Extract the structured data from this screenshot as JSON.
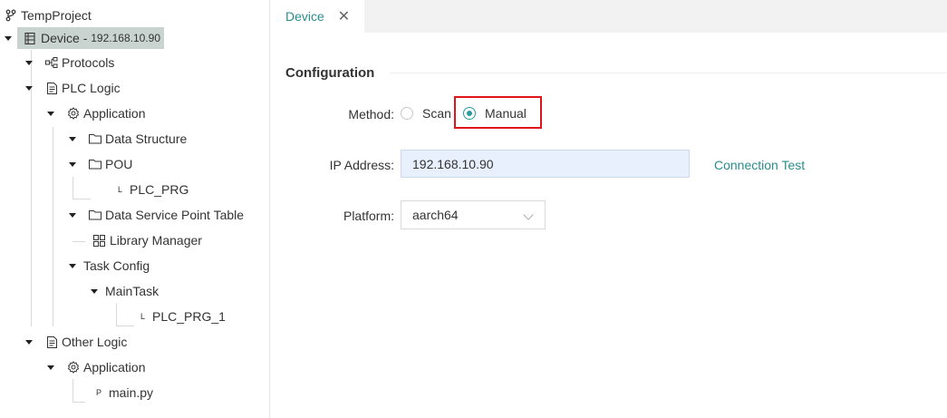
{
  "tree": {
    "root": {
      "label": "TempProject",
      "icon": "branch-icon"
    },
    "device": {
      "label": "Device - ",
      "ip": "192.168.10.90",
      "icon": "device-icon"
    },
    "protocols": {
      "label": "Protocols",
      "icon": "protocols-icon"
    },
    "plc_logic": {
      "label": "PLC Logic",
      "icon": "file-icon"
    },
    "application": {
      "label": "Application",
      "icon": "gear-icon"
    },
    "data_structure": {
      "label": "Data Structure",
      "icon": "folder-icon"
    },
    "pou": {
      "label": "POU",
      "icon": "folder-icon"
    },
    "plc_prg": {
      "label": "PLC_PRG",
      "prefix": "L"
    },
    "data_service": {
      "label": "Data Service Point Table",
      "icon": "folder-icon"
    },
    "library_manager": {
      "label": "Library Manager",
      "icon": "grid-icon"
    },
    "task_config": {
      "label": "Task Config"
    },
    "main_task": {
      "label": "MainTask"
    },
    "plc_prg_1": {
      "label": "PLC_PRG_1",
      "prefix": "L"
    },
    "other_logic": {
      "label": "Other Logic",
      "icon": "file-icon"
    },
    "application2": {
      "label": "Application",
      "icon": "gear-icon"
    },
    "main_py": {
      "label": "main.py",
      "prefix": "P"
    }
  },
  "tab": {
    "label": "Device",
    "close": "✕"
  },
  "config": {
    "title": "Configuration",
    "method_label": "Method:",
    "method_options": [
      "Scan",
      "Manual"
    ],
    "method_selected": "Manual",
    "ip_label": "IP Address:",
    "ip_value": "192.168.10.90",
    "connection_test": "Connection Test",
    "platform_label": "Platform:",
    "platform_value": "aarch64"
  },
  "colors": {
    "accent": "#2a9d9a",
    "highlight": "#e0141b",
    "selected_bg": "#c9d3d0",
    "input_bg": "#e8f0fe"
  }
}
